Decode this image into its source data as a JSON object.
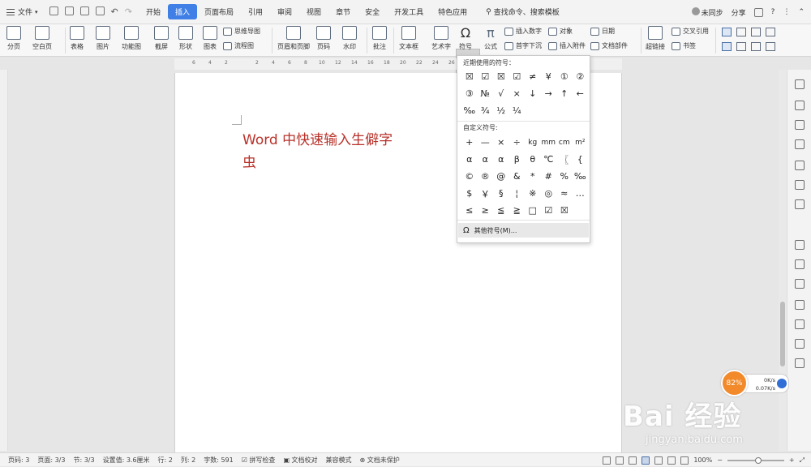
{
  "menubar": {
    "file_label": "文件",
    "tabs": [
      {
        "label": "开始"
      },
      {
        "label": "插入"
      },
      {
        "label": "页面布局"
      },
      {
        "label": "引用"
      },
      {
        "label": "审阅"
      },
      {
        "label": "视图"
      },
      {
        "label": "章节"
      },
      {
        "label": "安全"
      },
      {
        "label": "开发工具"
      },
      {
        "label": "特色应用"
      }
    ],
    "active_tab": "插入",
    "search_label": "查找命令、搜索模板",
    "sync_label": "未同步",
    "share_label": "分享",
    "help_label": "?",
    "accent_color": "#3f7fe6"
  },
  "ribbon": {
    "fenye": "分页",
    "kongbaiye": "空白页",
    "biaoge": "表格",
    "tupian": "图片",
    "gongnengtu": "功能图",
    "jieping": "截屏",
    "xingzhuang": "形状",
    "tubiao": "图表",
    "siweidaotu": "思维导图",
    "liuchengtu": "流程图",
    "yemeiyejiao": "页眉和页脚",
    "yema": "页码",
    "shuiyin": "水印",
    "pizhu": "批注",
    "wenbenkuang": "文本框",
    "yishuzi": "艺术字",
    "fuhao": "符号",
    "gongshi": "公式",
    "charushuzi": "插入数字",
    "duixiang": "对象",
    "riqi": "日期",
    "shouzixiachen": "首字下沉",
    "charufujian": "插入附件",
    "wendangbujian": "文档部件",
    "chaolianjie": "超链接",
    "jiaochayinyong": "交叉引用",
    "shuqian": "书签"
  },
  "ruler_ticks": [
    "6",
    "4",
    "2",
    "2",
    "4",
    "6",
    "8",
    "10",
    "12",
    "14",
    "16",
    "18",
    "20",
    "22",
    "24",
    "26",
    "28",
    "30",
    "32",
    "34",
    "36",
    "38",
    "40"
  ],
  "document": {
    "line1": "Word  中快速输入生僻字",
    "line2": "虫"
  },
  "symbol_dropdown": {
    "recent_header": "近期使用的符号：",
    "recent_symbols": [
      "☒",
      "☑",
      "☒",
      "☑",
      "≠",
      "¥",
      "①",
      "②",
      "③",
      "№",
      "√",
      "×",
      "↓",
      "→",
      "↑",
      "←",
      "‰",
      "¾",
      "½",
      "¼"
    ],
    "custom_header": "自定义符号:",
    "custom_symbols": [
      "+",
      "—",
      "×",
      "÷",
      "kg",
      "mm",
      "cm",
      "m²",
      "α",
      "α",
      "α",
      "β",
      "θ",
      "℃",
      "〖",
      "{",
      "©",
      "®",
      "@",
      "&",
      "*",
      "#",
      "%",
      "‰",
      "$",
      "￥",
      "§",
      "¦",
      "※",
      "◎",
      "≈",
      "…",
      "≤",
      "≥",
      "≦",
      "≧",
      "□",
      "☑",
      "☒"
    ],
    "more_label": "其他符号(M)..."
  },
  "status": {
    "yema": "页码: 3",
    "yemian": "页面: 3/3",
    "jie": "节: 3/3",
    "shezhi": "设置值: 3.6厘米",
    "hang": "行: 2",
    "lie": "列: 2",
    "zishu": "字数: 591",
    "pinxie": "拼写检查",
    "jiaodui": "文档校对",
    "jianrong": "兼容模式",
    "baohu": "文档未保护",
    "zoom": "100%"
  },
  "speed_widget": {
    "percent": "82%",
    "up": "0K/s",
    "down": "0.07K/s",
    "badge_color": "#f28a2c"
  },
  "watermark": {
    "big": "Bai 经验",
    "small": "jingyan.baidu.com"
  }
}
